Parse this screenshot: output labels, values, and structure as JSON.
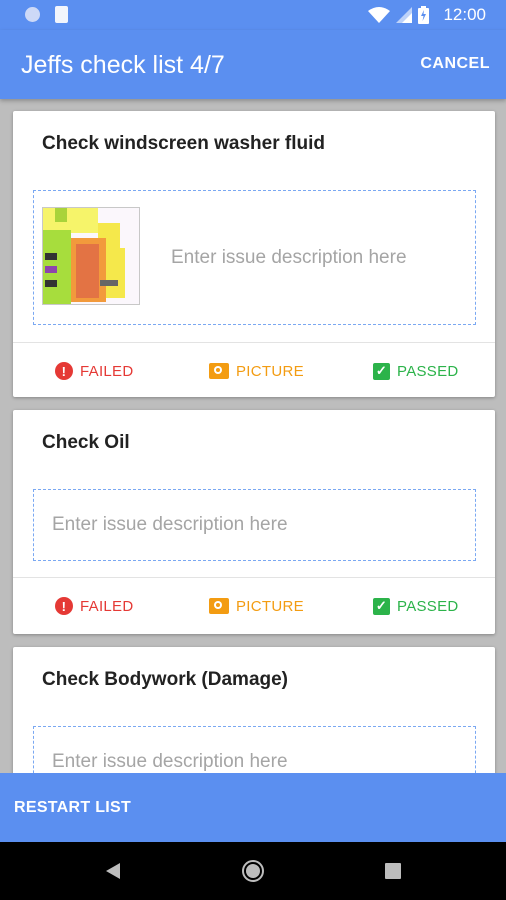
{
  "status_bar": {
    "time": "12:00"
  },
  "app_bar": {
    "title": "Jeffs check list 4/7",
    "cancel_label": "CANCEL"
  },
  "checklist": [
    {
      "title": "Check windscreen washer fluid",
      "placeholder": "Enter issue description here",
      "has_photo": true,
      "failed_label": "FAILED",
      "picture_label": "PICTURE",
      "passed_label": "PASSED"
    },
    {
      "title": "Check Oil",
      "placeholder": "Enter issue description here",
      "has_photo": false,
      "failed_label": "FAILED",
      "picture_label": "PICTURE",
      "passed_label": "PASSED"
    },
    {
      "title": "Check Bodywork (Damage)",
      "placeholder": "Enter issue description here",
      "has_photo": false
    }
  ],
  "bottom_bar": {
    "restart_label": "RESTART LIST"
  },
  "colors": {
    "primary": "#5b8ff0",
    "failed": "#e53935",
    "picture": "#f39c12",
    "passed": "#2cb34a"
  },
  "icons": {
    "failed": "alert-circle-icon",
    "picture": "camera-icon",
    "passed": "check-box-icon"
  }
}
